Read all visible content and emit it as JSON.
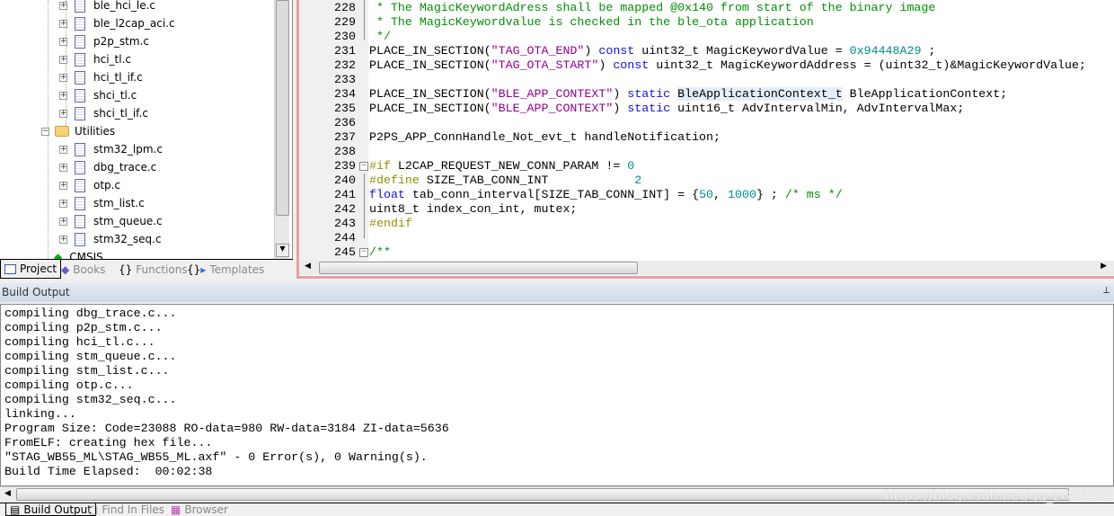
{
  "project_tree": {
    "items": [
      {
        "label": "ble_hci_le.c",
        "type": "file"
      },
      {
        "label": "ble_l2cap_aci.c",
        "type": "file"
      },
      {
        "label": "p2p_stm.c",
        "type": "file"
      },
      {
        "label": "hci_tl.c",
        "type": "file"
      },
      {
        "label": "hci_tl_if.c",
        "type": "file"
      },
      {
        "label": "shci_tl.c",
        "type": "file"
      },
      {
        "label": "shci_tl_if.c",
        "type": "file"
      },
      {
        "label": "Utilities",
        "type": "folder"
      },
      {
        "label": "stm32_lpm.c",
        "type": "file"
      },
      {
        "label": "dbg_trace.c",
        "type": "file"
      },
      {
        "label": "otp.c",
        "type": "file"
      },
      {
        "label": "stm_list.c",
        "type": "file"
      },
      {
        "label": "stm_queue.c",
        "type": "file"
      },
      {
        "label": "stm32_seq.c",
        "type": "file"
      },
      {
        "label": "CMSIS",
        "type": "component"
      }
    ]
  },
  "left_tabs": [
    "Project",
    "Books",
    "Functions",
    "Templates"
  ],
  "editor": {
    "lines": [
      {
        "n": "228",
        "fold": "",
        "tokens": [
          [
            " * The MagicKeywordAdress shall be mapped @0x140 from start of the binary image",
            "cm"
          ]
        ]
      },
      {
        "n": "229",
        "fold": "",
        "tokens": [
          [
            " * The MagicKeywordvalue is checked in the ble_ota application",
            "cm"
          ]
        ]
      },
      {
        "n": "230",
        "fold": "",
        "tokens": [
          [
            " */",
            "cm"
          ]
        ]
      },
      {
        "n": "231",
        "fold": "",
        "tokens": [
          [
            "PLACE_IN_SECTION(",
            ""
          ],
          [
            "\"TAG_OTA_END\"",
            "st"
          ],
          [
            ") ",
            ""
          ],
          [
            "const",
            "kw"
          ],
          [
            " uint32_t MagicKeywordValue = ",
            ""
          ],
          [
            "0x94448A29",
            "nm"
          ],
          [
            " ;",
            ""
          ]
        ]
      },
      {
        "n": "232",
        "fold": "",
        "tokens": [
          [
            "PLACE_IN_SECTION(",
            ""
          ],
          [
            "\"TAG_OTA_START\"",
            "st"
          ],
          [
            ") ",
            ""
          ],
          [
            "const",
            "kw"
          ],
          [
            " uint32_t MagicKeywordAddress = (uint32_t)&MagicKeywordValue;",
            ""
          ]
        ]
      },
      {
        "n": "233",
        "fold": "",
        "tokens": []
      },
      {
        "n": "234",
        "fold": "",
        "tokens": [
          [
            "PLACE_IN_SECTION(",
            ""
          ],
          [
            "\"BLE_APP_CONTEXT\"",
            "st"
          ],
          [
            ") ",
            ""
          ],
          [
            "static",
            "kw"
          ],
          [
            " ",
            ""
          ],
          [
            "BleApplicationContext_t",
            "hl"
          ],
          [
            " BleApplicationContext;",
            ""
          ]
        ]
      },
      {
        "n": "235",
        "fold": "",
        "tokens": [
          [
            "PLACE_IN_SECTION(",
            ""
          ],
          [
            "\"BLE_APP_CONTEXT\"",
            "st"
          ],
          [
            ") ",
            ""
          ],
          [
            "static",
            "kw"
          ],
          [
            " uint16_t AdvIntervalMin, AdvIntervalMax;",
            ""
          ]
        ]
      },
      {
        "n": "236",
        "fold": "",
        "tokens": []
      },
      {
        "n": "237",
        "fold": "",
        "tokens": [
          [
            "P2PS_APP_ConnHandle_Not_evt_t handleNotification;",
            ""
          ]
        ]
      },
      {
        "n": "238",
        "fold": "",
        "tokens": []
      },
      {
        "n": "239",
        "fold": "minus",
        "tokens": [
          [
            "#if",
            "pp"
          ],
          [
            " L2CAP_REQUEST_NEW_CONN_PARAM != ",
            ""
          ],
          [
            "0",
            "nm"
          ]
        ]
      },
      {
        "n": "240",
        "fold": "",
        "tokens": [
          [
            "#define",
            "pp"
          ],
          [
            " SIZE_TAB_CONN_INT            ",
            ""
          ],
          [
            "2",
            "nm"
          ]
        ]
      },
      {
        "n": "241",
        "fold": "",
        "tokens": [
          [
            "float",
            "kw"
          ],
          [
            " tab_conn_interval[SIZE_TAB_CONN_INT] = {",
            ""
          ],
          [
            "50",
            "nm"
          ],
          [
            ", ",
            ""
          ],
          [
            "1000",
            "nm"
          ],
          [
            "} ; ",
            ""
          ],
          [
            "/* ms */",
            "cm"
          ]
        ]
      },
      {
        "n": "242",
        "fold": "",
        "tokens": [
          [
            "uint8_t index_con_int, mutex;",
            ""
          ]
        ]
      },
      {
        "n": "243",
        "fold": "",
        "tokens": [
          [
            "#endif",
            "pp"
          ]
        ]
      },
      {
        "n": "244",
        "fold": "",
        "tokens": []
      },
      {
        "n": "245",
        "fold": "minus",
        "tokens": [
          [
            "/**",
            "cm"
          ]
        ]
      }
    ]
  },
  "build_output": {
    "title": "Build Output",
    "lines": [
      "compiling dbg_trace.c...",
      "compiling p2p_stm.c...",
      "compiling hci_tl.c...",
      "compiling stm_queue.c...",
      "compiling stm_list.c...",
      "compiling otp.c...",
      "compiling stm32_seq.c...",
      "linking...",
      "Program Size: Code=23088 RO-data=980 RW-data=3184 ZI-data=5636",
      "FromELF: creating hex file...",
      "\"STAG_WB55_ML\\STAG_WB55_ML.axf\" - 0 Error(s), 0 Warning(s).",
      "Build Time Elapsed:  00:02:38"
    ]
  },
  "bottom_tabs": [
    "Build Output",
    "Find In Files",
    "Browser"
  ],
  "watermark": "https://blog.csdn.net/qq_28851611"
}
